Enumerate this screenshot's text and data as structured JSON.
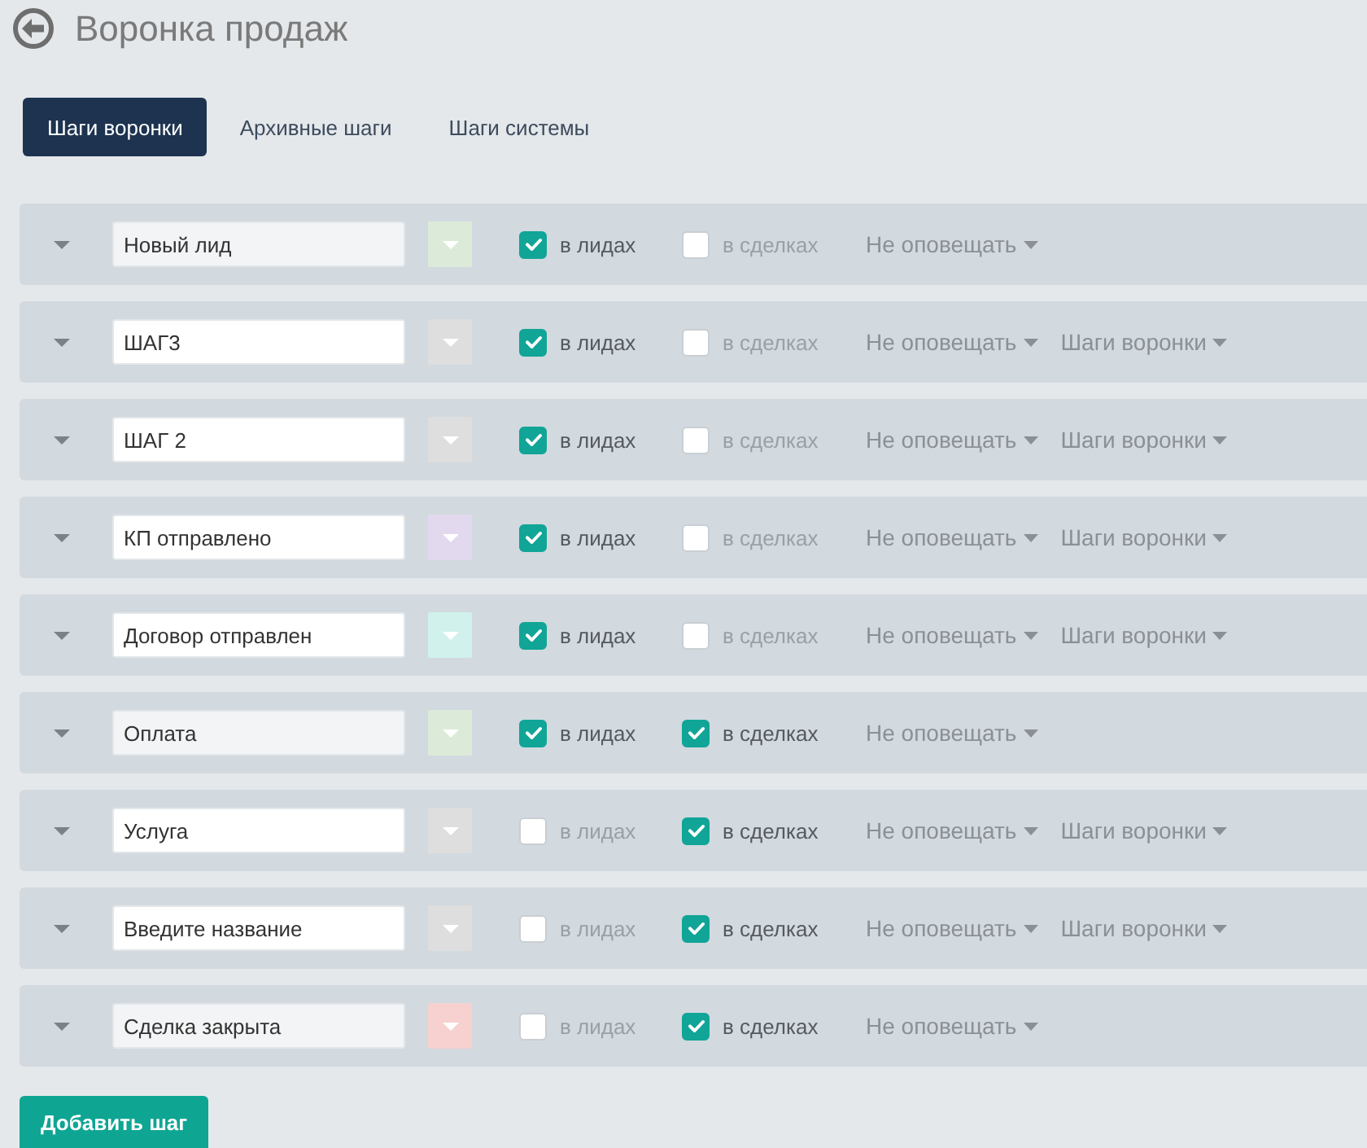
{
  "header": {
    "title": "Воронка продаж"
  },
  "tabs": [
    {
      "label": "Шаги воронки",
      "selected": true
    },
    {
      "label": "Архивные шаги",
      "selected": false
    },
    {
      "label": "Шаги системы",
      "selected": false
    }
  ],
  "steps": [
    {
      "name": "Новый лид",
      "disabled": true,
      "color": "#dcebd9",
      "checkboxes": [
        {
          "label": "в лидах",
          "checked": true
        },
        {
          "label": "в сделках",
          "checked": false
        }
      ],
      "dropdowns": [
        "Не оповещать"
      ]
    },
    {
      "name": "ШАГ3",
      "disabled": false,
      "color": "#dedede",
      "checkboxes": [
        {
          "label": "в лидах",
          "checked": true
        },
        {
          "label": "в сделках",
          "checked": false
        }
      ],
      "dropdowns": [
        "Не оповещать",
        "Шаги воронки"
      ]
    },
    {
      "name": "ШАГ 2",
      "disabled": false,
      "color": "#dedede",
      "checkboxes": [
        {
          "label": "в лидах",
          "checked": true
        },
        {
          "label": "в сделках",
          "checked": false
        }
      ],
      "dropdowns": [
        "Не оповещать",
        "Шаги воронки"
      ]
    },
    {
      "name": "КП отправлено",
      "disabled": false,
      "color": "#e3d9ee",
      "checkboxes": [
        {
          "label": "в лидах",
          "checked": true
        },
        {
          "label": "в сделках",
          "checked": false
        }
      ],
      "dropdowns": [
        "Не оповещать",
        "Шаги воронки"
      ]
    },
    {
      "name": "Договор отправлен",
      "disabled": false,
      "color": "#d1f2ec",
      "checkboxes": [
        {
          "label": "в лидах",
          "checked": true
        },
        {
          "label": "в сделках",
          "checked": false
        }
      ],
      "dropdowns": [
        "Не оповещать",
        "Шаги воронки"
      ]
    },
    {
      "name": "Оплата",
      "disabled": true,
      "color": "#dcebd9",
      "checkboxes": [
        {
          "label": "в лидах",
          "checked": true
        },
        {
          "label": "в сделках",
          "checked": true
        }
      ],
      "dropdowns": [
        "Не оповещать"
      ]
    },
    {
      "name": "Услуга",
      "disabled": false,
      "color": "#dedede",
      "checkboxes": [
        {
          "label": "в лидах",
          "checked": false
        },
        {
          "label": "в сделках",
          "checked": true
        }
      ],
      "dropdowns": [
        "Не оповещать",
        "Шаги воронки"
      ]
    },
    {
      "name": "Введите название",
      "disabled": false,
      "color": "#dedede",
      "checkboxes": [
        {
          "label": "в лидах",
          "checked": false
        },
        {
          "label": "в сделках",
          "checked": true
        }
      ],
      "dropdowns": [
        "Не оповещать",
        "Шаги воронки"
      ]
    },
    {
      "name": "Сделка закрыта",
      "disabled": true,
      "color": "#f6d1d0",
      "checkboxes": [
        {
          "label": "в лидах",
          "checked": false
        },
        {
          "label": "в сделках",
          "checked": true
        }
      ],
      "dropdowns": [
        "Не оповещать"
      ]
    }
  ],
  "add_button": {
    "label": "Добавить шаг"
  }
}
